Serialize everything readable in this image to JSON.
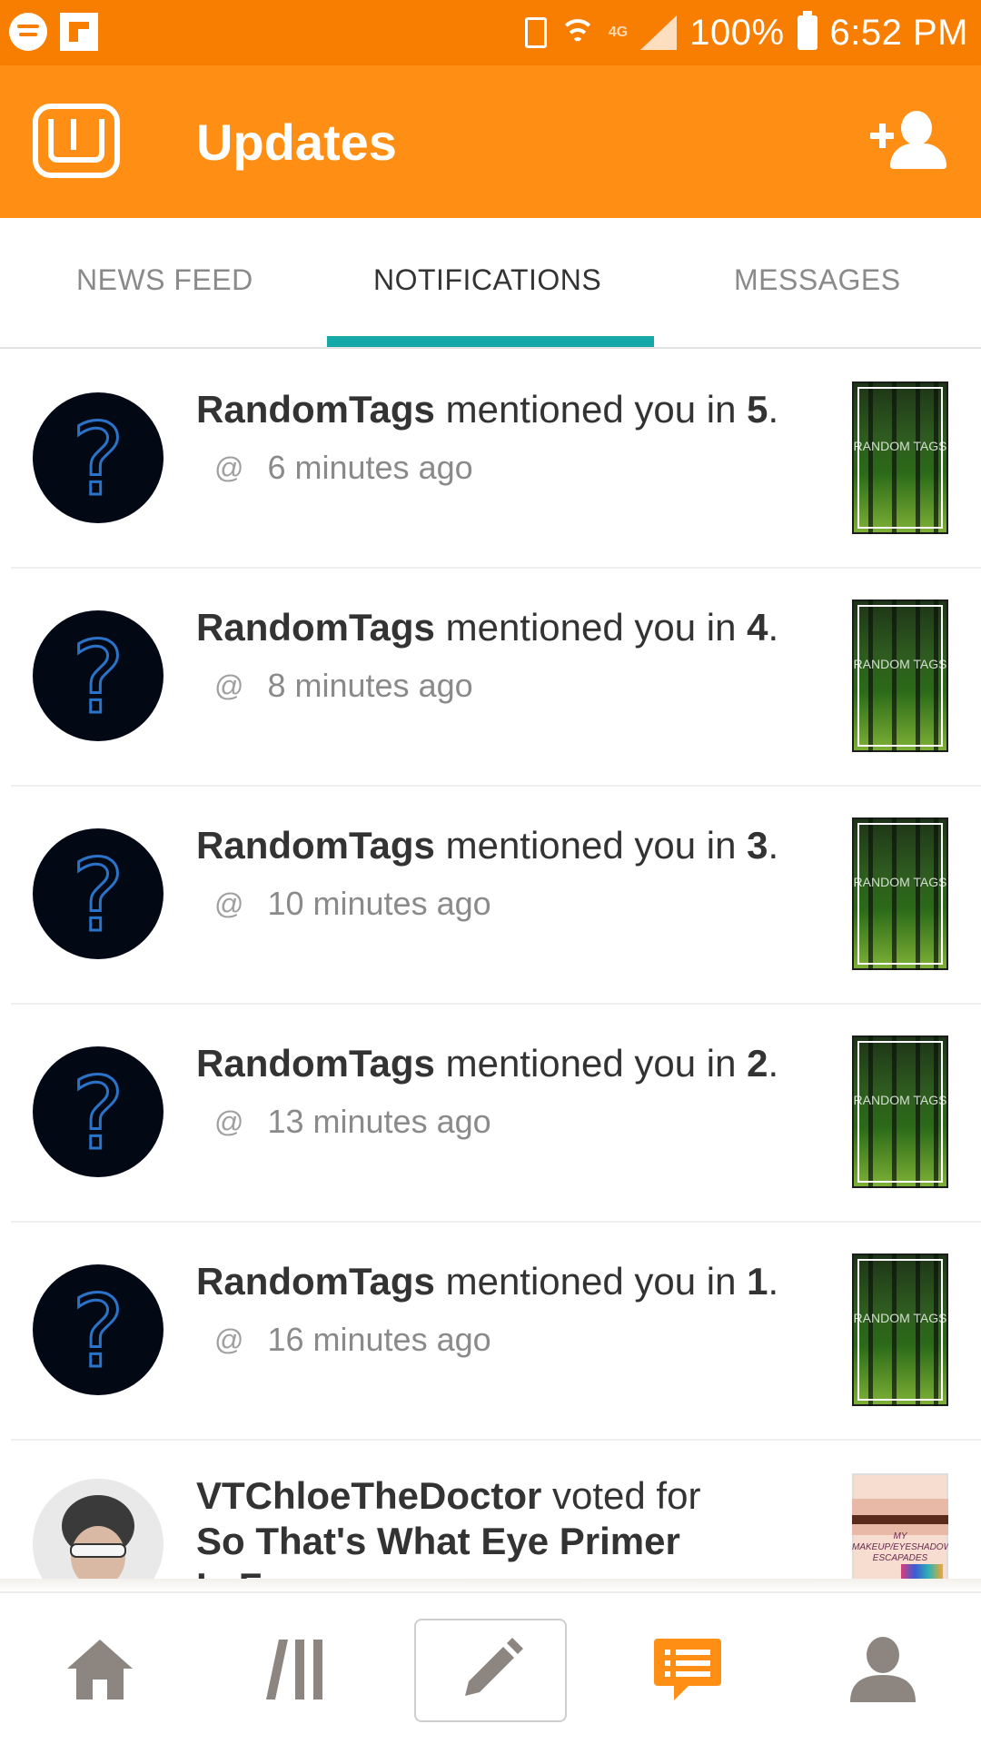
{
  "status_bar": {
    "battery_percent": "100%",
    "time": "6:52 PM",
    "network": "4G"
  },
  "app_bar": {
    "title": "Updates"
  },
  "tabs": [
    {
      "label": "NEWS FEED",
      "active": false
    },
    {
      "label": "NOTIFICATIONS",
      "active": true
    },
    {
      "label": "MESSAGES",
      "active": false
    }
  ],
  "notifications": [
    {
      "user": "RandomTags",
      "action": "mentioned you in",
      "target": "5",
      "time": "6 minutes ago"
    },
    {
      "user": "RandomTags",
      "action": "mentioned you in",
      "target": "4",
      "time": "8 minutes ago"
    },
    {
      "user": "RandomTags",
      "action": "mentioned you in",
      "target": "3",
      "time": "10 minutes ago"
    },
    {
      "user": "RandomTags",
      "action": "mentioned you in",
      "target": "2",
      "time": "13 minutes ago"
    },
    {
      "user": "RandomTags",
      "action": "mentioned you in",
      "target": "1",
      "time": "16 minutes ago"
    },
    {
      "user": "VTChloeTheDoctor",
      "action": "voted for",
      "target": "So That's What Eye Primer Is For",
      "time": ""
    }
  ],
  "thumbnails": {
    "random_tags_cover_text": "RANDOM TAGS",
    "makeup_cover_text": "MY MAKEUP/EYESHADOW ESCAPADES"
  },
  "colors": {
    "status_bar": "#f77e00",
    "app_bar": "#ff8f14",
    "tab_indicator": "#14a8a8",
    "accent_orange": "#ff8f14",
    "nav_icon_gray": "#8c8580"
  },
  "bottom_nav": [
    {
      "icon": "home-icon"
    },
    {
      "icon": "library-icon"
    },
    {
      "icon": "write-pencil-icon"
    },
    {
      "icon": "notifications-chat-icon"
    },
    {
      "icon": "profile-icon"
    }
  ]
}
